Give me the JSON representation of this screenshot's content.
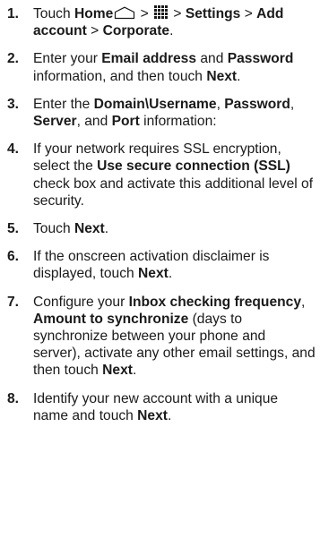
{
  "icons": {
    "home": "home-icon",
    "apps": "apps-grid-icon"
  },
  "steps": [
    {
      "num": "1.",
      "parts": [
        {
          "t": "Touch "
        },
        {
          "t": "Home",
          "b": true
        },
        {
          "icon": "home"
        },
        {
          "t": " > "
        },
        {
          "icon": "apps"
        },
        {
          "t": " > "
        },
        {
          "t": "Settings",
          "b": true
        },
        {
          "t": " > "
        },
        {
          "t": "Add account",
          "b": true
        },
        {
          "t": " > "
        },
        {
          "t": "Corporate",
          "b": true
        },
        {
          "t": "."
        }
      ]
    },
    {
      "num": "2.",
      "parts": [
        {
          "t": "Enter your "
        },
        {
          "t": "Email address",
          "b": true
        },
        {
          "t": " and "
        },
        {
          "t": "Password",
          "b": true
        },
        {
          "t": " information, and then touch "
        },
        {
          "t": "Next",
          "b": true
        },
        {
          "t": "."
        }
      ]
    },
    {
      "num": "3.",
      "parts": [
        {
          "t": "Enter the "
        },
        {
          "t": "Domain\\Username",
          "b": true
        },
        {
          "t": ", "
        },
        {
          "t": "Password",
          "b": true
        },
        {
          "t": ", "
        },
        {
          "t": "Server",
          "b": true
        },
        {
          "t": ", and "
        },
        {
          "t": "Port",
          "b": true
        },
        {
          "t": " information:"
        }
      ]
    },
    {
      "num": "4.",
      "parts": [
        {
          "t": "If your network requires SSL encryption, select the "
        },
        {
          "t": "Use secure connection (SSL)",
          "b": true
        },
        {
          "t": " check box and activate this additional level of security."
        }
      ]
    },
    {
      "num": "5.",
      "parts": [
        {
          "t": "Touch "
        },
        {
          "t": "Next",
          "b": true
        },
        {
          "t": "."
        }
      ]
    },
    {
      "num": "6.",
      "parts": [
        {
          "t": "If the onscreen activation disclaimer is displayed, touch "
        },
        {
          "t": "Next",
          "b": true
        },
        {
          "t": "."
        }
      ]
    },
    {
      "num": "7.",
      "parts": [
        {
          "t": "Configure your "
        },
        {
          "t": "Inbox checking frequency",
          "b": true
        },
        {
          "t": ", "
        },
        {
          "t": "Amount to synchronize",
          "b": true
        },
        {
          "t": " (days to synchronize between your phone and server), activate any other email settings, and then touch "
        },
        {
          "t": "Next",
          "b": true
        },
        {
          "t": "."
        }
      ]
    },
    {
      "num": "8.",
      "parts": [
        {
          "t": "Identify your new account with a unique name and touch "
        },
        {
          "t": "Next",
          "b": true
        },
        {
          "t": "."
        }
      ]
    }
  ]
}
